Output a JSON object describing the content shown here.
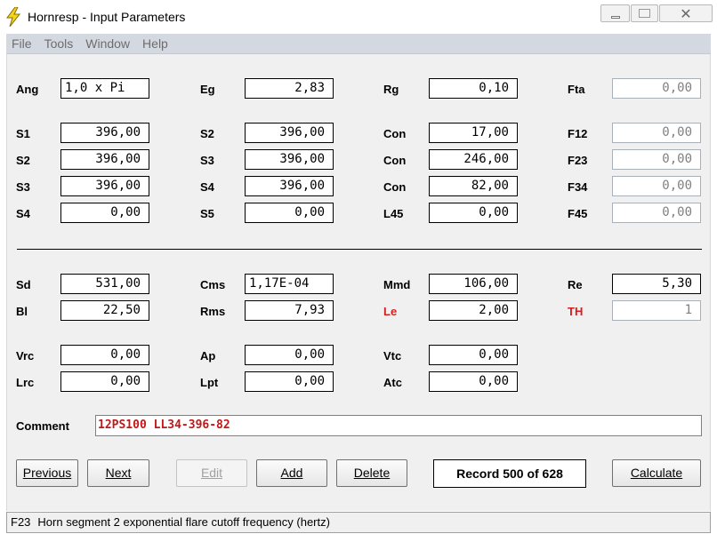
{
  "window": {
    "title": "Hornresp - Input Parameters",
    "close_glyph": "✕",
    "icon": "lightning-bolt-icon"
  },
  "menu": [
    "File",
    "Tools",
    "Window",
    "Help"
  ],
  "rows": {
    "row1": [
      {
        "label": "Ang",
        "value": "1,0 x Pi",
        "red": false,
        "disabled": false
      },
      {
        "label": "Eg",
        "value": "2,83",
        "red": false,
        "disabled": false
      },
      {
        "label": "Rg",
        "value": "0,10",
        "red": false,
        "disabled": false
      },
      {
        "label": "Fta",
        "value": "0,00",
        "red": false,
        "disabled": true
      }
    ],
    "row2": [
      {
        "label": "S1",
        "value": "396,00",
        "red": false,
        "disabled": false
      },
      {
        "label": "S2",
        "value": "396,00",
        "red": false,
        "disabled": false
      },
      {
        "label": "Con",
        "value": "17,00",
        "red": false,
        "disabled": false
      },
      {
        "label": "F12",
        "value": "0,00",
        "red": false,
        "disabled": true
      }
    ],
    "row3": [
      {
        "label": "S2",
        "value": "396,00",
        "red": false,
        "disabled": false
      },
      {
        "label": "S3",
        "value": "396,00",
        "red": false,
        "disabled": false
      },
      {
        "label": "Con",
        "value": "246,00",
        "red": false,
        "disabled": false
      },
      {
        "label": "F23",
        "value": "0,00",
        "red": false,
        "disabled": true
      }
    ],
    "row4": [
      {
        "label": "S3",
        "value": "396,00",
        "red": false,
        "disabled": false
      },
      {
        "label": "S4",
        "value": "396,00",
        "red": false,
        "disabled": false
      },
      {
        "label": "Con",
        "value": "82,00",
        "red": false,
        "disabled": false
      },
      {
        "label": "F34",
        "value": "0,00",
        "red": false,
        "disabled": true
      }
    ],
    "row5": [
      {
        "label": "S4",
        "value": "0,00",
        "red": false,
        "disabled": false
      },
      {
        "label": "S5",
        "value": "0,00",
        "red": false,
        "disabled": false
      },
      {
        "label": "L45",
        "value": "0,00",
        "red": false,
        "disabled": false
      },
      {
        "label": "F45",
        "value": "0,00",
        "red": false,
        "disabled": true
      }
    ],
    "row6": [
      {
        "label": "Sd",
        "value": "531,00",
        "red": false,
        "disabled": false
      },
      {
        "label": "Cms",
        "value": "1,17E-04",
        "red": false,
        "disabled": false
      },
      {
        "label": "Mmd",
        "value": "106,00",
        "red": false,
        "disabled": false
      },
      {
        "label": "Re",
        "value": "5,30",
        "red": false,
        "disabled": false
      }
    ],
    "row7": [
      {
        "label": "Bl",
        "value": "22,50",
        "red": false,
        "disabled": false
      },
      {
        "label": "Rms",
        "value": "7,93",
        "red": false,
        "disabled": false
      },
      {
        "label": "Le",
        "value": "2,00",
        "red": true,
        "disabled": false
      },
      {
        "label": "TH",
        "value": "1",
        "red": true,
        "disabled": true
      }
    ],
    "row8": [
      {
        "label": "Vrc",
        "value": "0,00",
        "red": false,
        "disabled": false
      },
      {
        "label": "Ap",
        "value": "0,00",
        "red": false,
        "disabled": false
      },
      {
        "label": "Vtc",
        "value": "0,00",
        "red": false,
        "disabled": false
      }
    ],
    "row9": [
      {
        "label": "Lrc",
        "value": "0,00",
        "red": false,
        "disabled": false
      },
      {
        "label": "Lpt",
        "value": "0,00",
        "red": false,
        "disabled": false
      },
      {
        "label": "Atc",
        "value": "0,00",
        "red": false,
        "disabled": false
      }
    ]
  },
  "comment": {
    "label": "Comment",
    "value": "12PS100 LL34-396-82"
  },
  "buttons": {
    "previous": "Previous",
    "next": "Next",
    "edit": "Edit",
    "add": "Add",
    "delete": "Delete",
    "calculate": "Calculate"
  },
  "record": "Record 500 of 628",
  "status": {
    "code": "F23",
    "description": "Horn segment 2 exponential flare cutoff frequency  (hertz)"
  }
}
